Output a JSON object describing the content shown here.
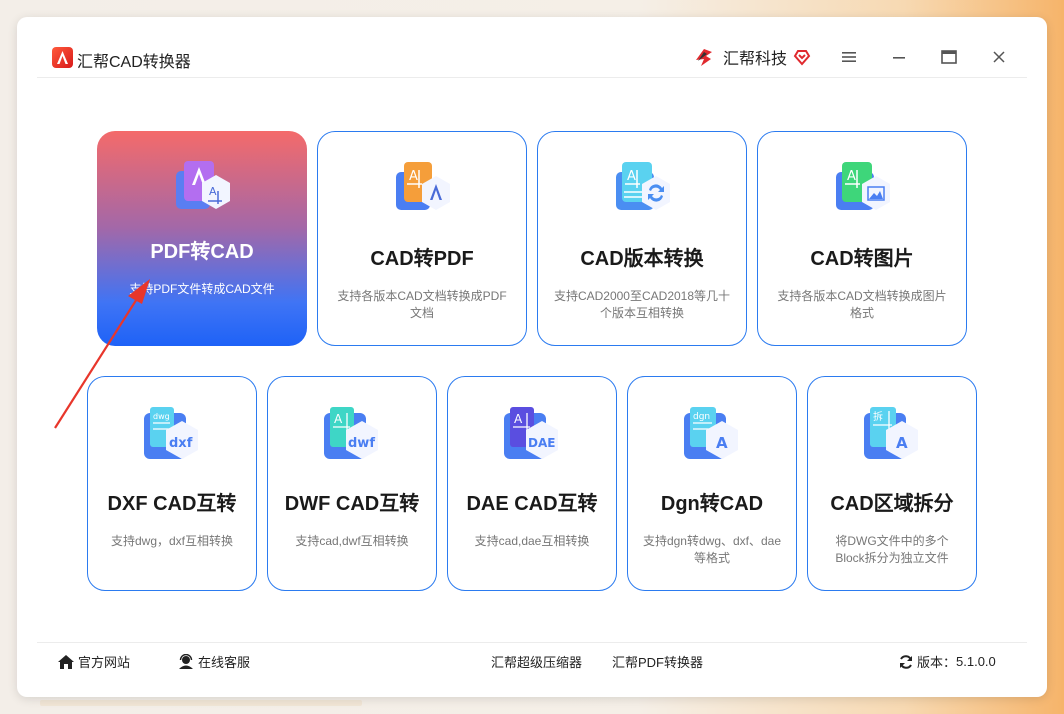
{
  "app": {
    "title": "汇帮CAD转换器"
  },
  "brand": {
    "name": "汇帮科技"
  },
  "window_controls": {
    "menu": "menu-icon",
    "minimize": "minimize-icon",
    "maximize": "maximize-icon",
    "close": "close-icon"
  },
  "cards_row1": [
    {
      "title": "PDF转CAD",
      "desc": "支持PDF文件转成CAD文件",
      "active": true
    },
    {
      "title": "CAD转PDF",
      "desc": "支持各版本CAD文档转换成PDF文档"
    },
    {
      "title": "CAD版本转换",
      "desc": "支持CAD2000至CAD2018等几十个版本互相转换"
    },
    {
      "title": "CAD转图片",
      "desc": "支持各版本CAD文档转换成图片格式"
    }
  ],
  "cards_row2": [
    {
      "title": "DXF CAD互转",
      "desc": "支持dwg，dxf互相转换",
      "icon_text": "dxf",
      "tag": "dwg"
    },
    {
      "title": "DWF CAD互转",
      "desc": "支持cad,dwf互相转换",
      "icon_text": "dwf"
    },
    {
      "title": "DAE CAD互转",
      "desc": "支持cad,dae互相转换",
      "icon_text": "DAE"
    },
    {
      "title": "Dgn转CAD",
      "desc": "支持dgn转dwg、dxf、dae等格式",
      "tag": "dgn"
    },
    {
      "title": "CAD区域拆分",
      "desc": "将DWG文件中的多个Block拆分为独立文件",
      "tag": "拆"
    }
  ],
  "footer": {
    "website": "官方网站",
    "support": "在线客服",
    "compressor": "汇帮超级压缩器",
    "pdf_converter": "汇帮PDF转换器",
    "version_label": "版本：",
    "version": "5.1.0.0"
  },
  "colors": {
    "accent": "#2b7bf0",
    "active_top": "#f46a6a",
    "active_bottom": "#1e62f7",
    "arrow": "#e8362b"
  }
}
